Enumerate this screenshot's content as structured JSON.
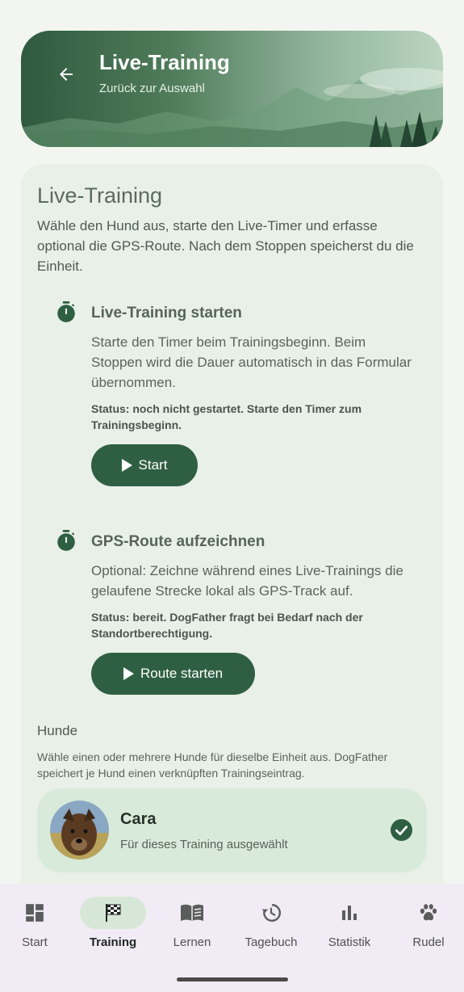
{
  "header": {
    "title": "Live-Training",
    "subtitle": "Zurück zur Auswahl"
  },
  "card": {
    "title": "Live-Training",
    "intro": "Wähle den Hund aus, starte den Live-Timer und erfasse optional die GPS-Route. Nach dem Stoppen speicherst du die Einheit."
  },
  "timer": {
    "title": "Live-Training starten",
    "description": "Starte den Timer beim Trainingsbeginn. Beim Stoppen wird die Dauer automatisch in das Formular übernommen.",
    "status": "Status: noch nicht gestartet. Starte den Timer zum Trainingsbeginn.",
    "button_label": "Start"
  },
  "gps": {
    "title": "GPS-Route aufzeichnen",
    "description": "Optional: Zeichne während eines Live-Trainings die gelaufene Strecke lokal als GPS-Track auf.",
    "status": "Status: bereit. DogFather fragt bei Bedarf nach der Standortberechtigung.",
    "button_label": "Route starten"
  },
  "dogs": {
    "title": "Hunde",
    "description": "Wähle einen oder mehrere Hunde für dieselbe Einheit aus. DogFather speichert je Hund einen verknüpften Trainingseintrag.",
    "items": [
      {
        "name": "Cara",
        "status": "Für dieses Training ausgewählt",
        "selected": true
      }
    ]
  },
  "nav": {
    "items": [
      {
        "label": "Start",
        "icon": "dashboard-icon"
      },
      {
        "label": "Training",
        "icon": "checkered-flag-icon",
        "active": true
      },
      {
        "label": "Lernen",
        "icon": "book-icon"
      },
      {
        "label": "Tagebuch",
        "icon": "history-icon"
      },
      {
        "label": "Statistik",
        "icon": "bar-chart-icon"
      },
      {
        "label": "Rudel",
        "icon": "paw-icon"
      }
    ]
  },
  "colors": {
    "primary": "#2f5f43",
    "card_bg": "#e9f0e8",
    "dog_card_bg": "#d8ead9",
    "nav_bg": "#f1ebf5",
    "nav_active_pill": "#d7e7d7"
  }
}
